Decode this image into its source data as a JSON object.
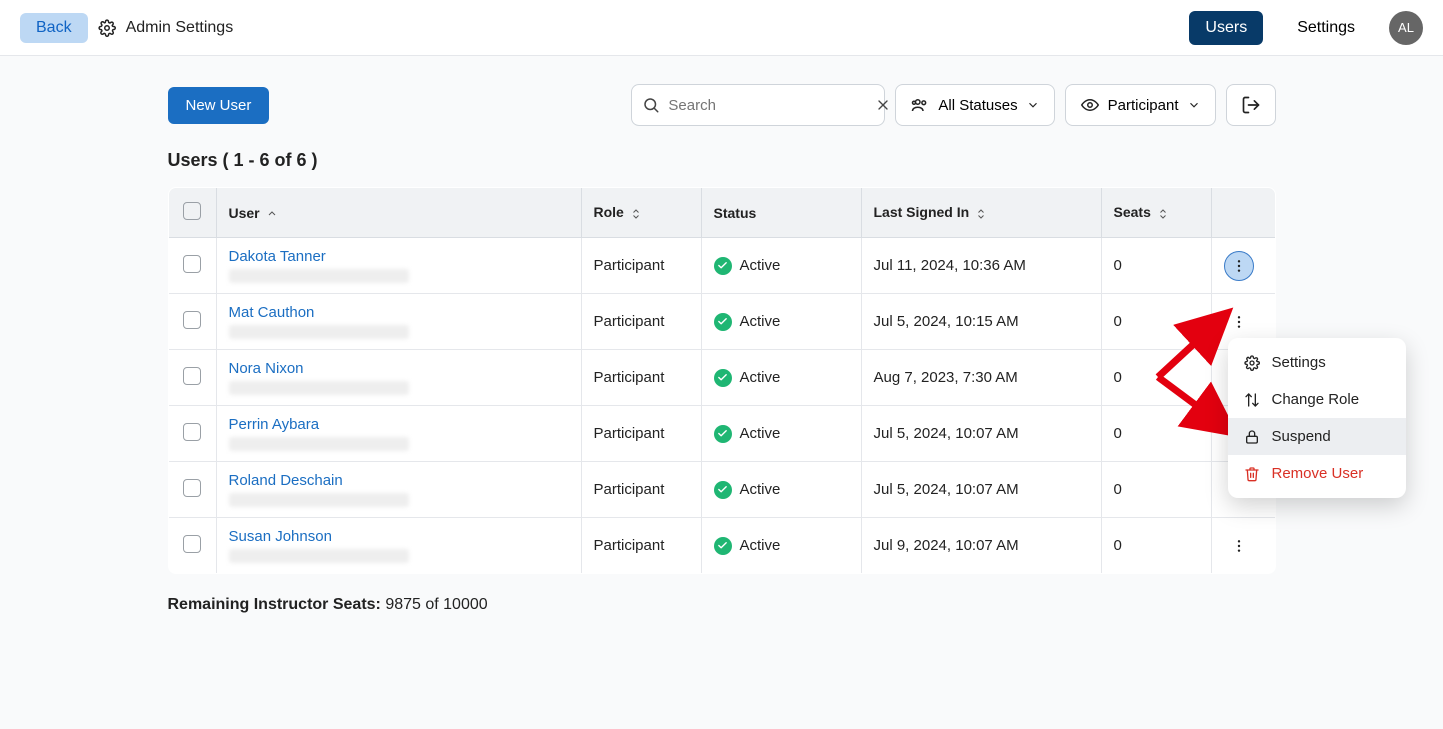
{
  "header": {
    "back": "Back",
    "title": "Admin Settings",
    "nav_users": "Users",
    "nav_settings": "Settings",
    "avatar": "AL"
  },
  "toolbar": {
    "new_user": "New User",
    "search_placeholder": "Search",
    "status_filter": "All Statuses",
    "role_filter": "Participant"
  },
  "list": {
    "title": "Users ( 1 - 6 of 6 )"
  },
  "columns": {
    "user": "User",
    "role": "Role",
    "status": "Status",
    "last": "Last Signed In",
    "seats": "Seats"
  },
  "rows": [
    {
      "name": "Dakota Tanner",
      "role": "Participant",
      "status": "Active",
      "last": "Jul 11, 2024, 10:36 AM",
      "seats": "0"
    },
    {
      "name": "Mat Cauthon",
      "role": "Participant",
      "status": "Active",
      "last": "Jul 5, 2024, 10:15 AM",
      "seats": "0"
    },
    {
      "name": "Nora Nixon",
      "role": "Participant",
      "status": "Active",
      "last": "Aug 7, 2023, 7:30 AM",
      "seats": "0"
    },
    {
      "name": "Perrin Aybara",
      "role": "Participant",
      "status": "Active",
      "last": "Jul 5, 2024, 10:07 AM",
      "seats": "0"
    },
    {
      "name": "Roland Deschain",
      "role": "Participant",
      "status": "Active",
      "last": "Jul 5, 2024, 10:07 AM",
      "seats": "0"
    },
    {
      "name": "Susan Johnson",
      "role": "Participant",
      "status": "Active",
      "last": "Jul 9, 2024, 10:07 AM",
      "seats": "0"
    }
  ],
  "popover": {
    "settings": "Settings",
    "change_role": "Change Role",
    "suspend": "Suspend",
    "remove": "Remove User"
  },
  "footer": {
    "label": "Remaining Instructor Seats:",
    "value": "9875 of 10000"
  }
}
